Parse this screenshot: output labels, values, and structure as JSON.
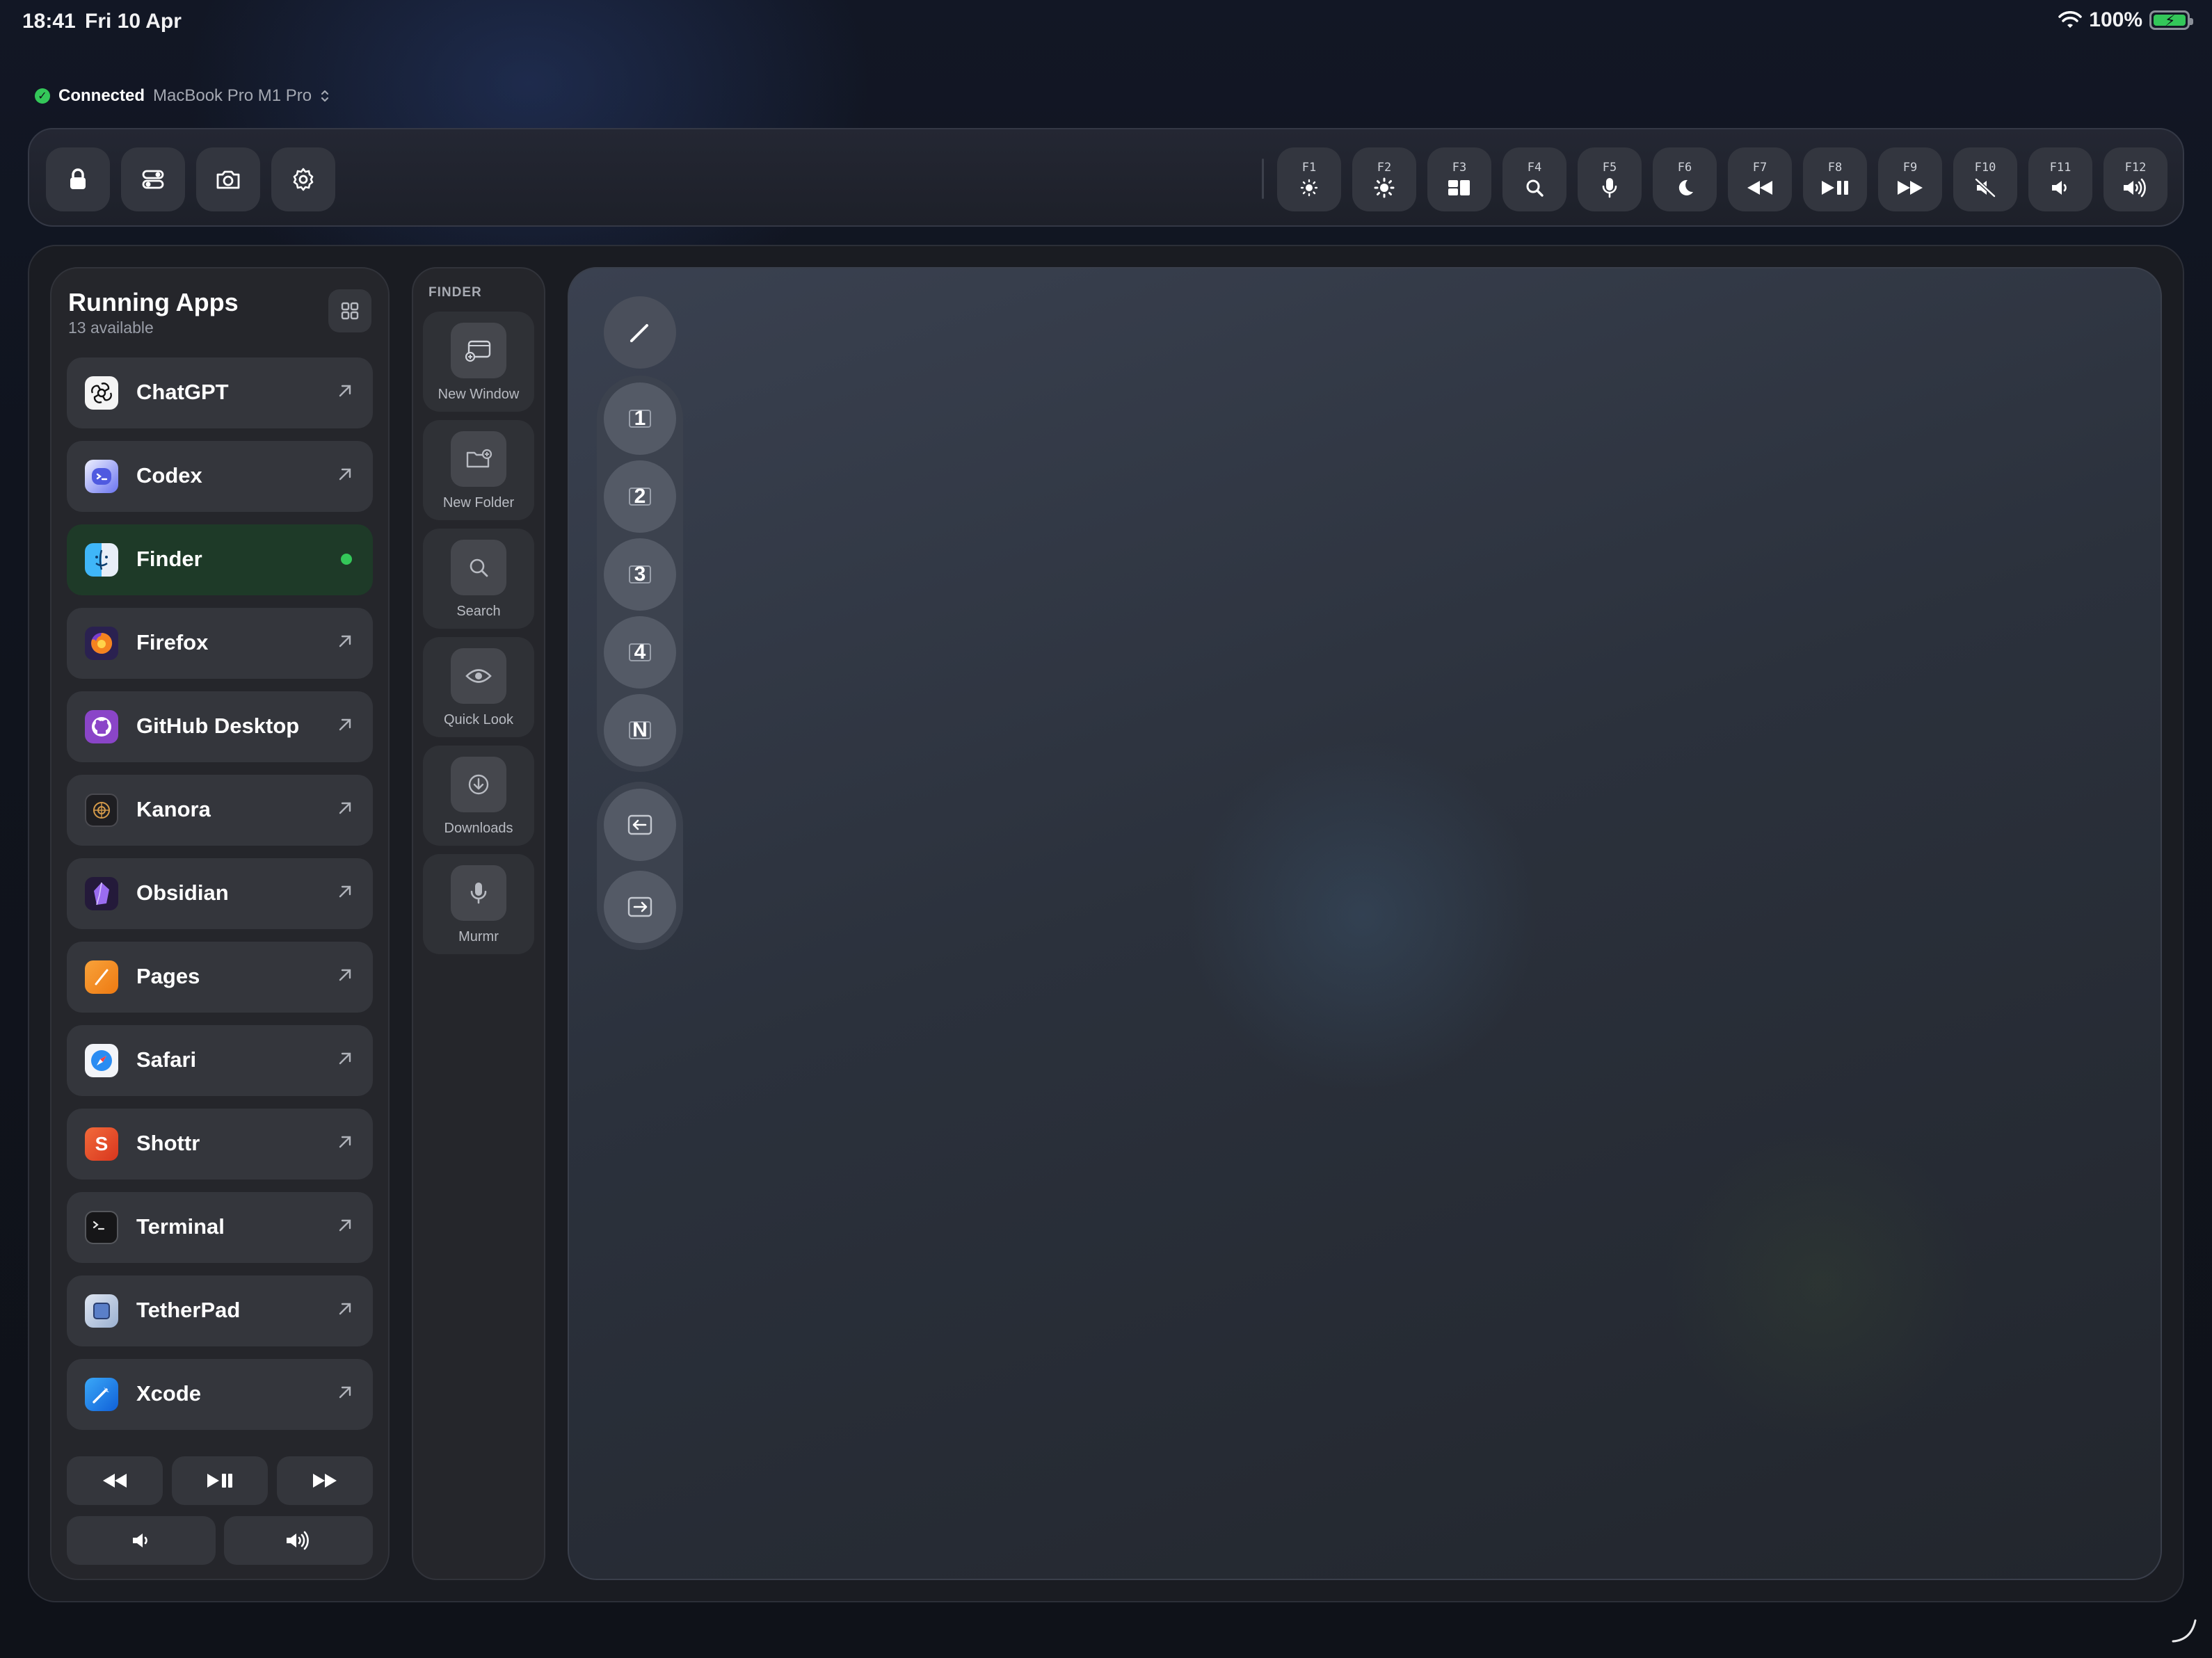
{
  "status_bar": {
    "time": "18:41",
    "date": "Fri 10 Apr",
    "battery": "100%"
  },
  "connection": {
    "status": "Connected",
    "device": "MacBook Pro M1 Pro"
  },
  "toolbar": {
    "left_buttons": [
      "lock-icon",
      "toggles-icon",
      "camera-icon",
      "gear-icon"
    ],
    "fkeys": [
      {
        "label": "F1",
        "icon": "brightness-down-icon"
      },
      {
        "label": "F2",
        "icon": "brightness-up-icon"
      },
      {
        "label": "F3",
        "icon": "mission-control-icon"
      },
      {
        "label": "F4",
        "icon": "spotlight-icon"
      },
      {
        "label": "F5",
        "icon": "dictation-icon"
      },
      {
        "label": "F6",
        "icon": "do-not-disturb-icon"
      },
      {
        "label": "F7",
        "icon": "rewind-icon"
      },
      {
        "label": "F8",
        "icon": "play-pause-icon"
      },
      {
        "label": "F9",
        "icon": "fast-forward-icon"
      },
      {
        "label": "F10",
        "icon": "mute-icon"
      },
      {
        "label": "F11",
        "icon": "volume-down-icon"
      },
      {
        "label": "F12",
        "icon": "volume-up-icon"
      }
    ]
  },
  "running_apps": {
    "title": "Running Apps",
    "subtitle": "13 available",
    "apps": [
      {
        "name": "ChatGPT",
        "active": false
      },
      {
        "name": "Codex",
        "active": false
      },
      {
        "name": "Finder",
        "active": true
      },
      {
        "name": "Firefox",
        "active": false
      },
      {
        "name": "GitHub Desktop",
        "active": false
      },
      {
        "name": "Kanora",
        "active": false
      },
      {
        "name": "Obsidian",
        "active": false
      },
      {
        "name": "Pages",
        "active": false
      },
      {
        "name": "Safari",
        "active": false
      },
      {
        "name": "Shottr",
        "active": false
      },
      {
        "name": "Terminal",
        "active": false
      },
      {
        "name": "TetherPad",
        "active": false
      },
      {
        "name": "Xcode",
        "active": false
      }
    ],
    "app_colors": {
      "ChatGPT": "#f4f4f4",
      "Codex": "#5a64e8",
      "Finder": "#2a9af0",
      "Firefox": "#e8632a",
      "GitHub Desktop": "#7a3fb8",
      "Kanora": "#2a2a2e",
      "Obsidian": "#4a2f8a",
      "Pages": "#f08a1c",
      "Safari": "#1e88f0",
      "Shottr": "#e8442a",
      "Terminal": "#1a1a1c",
      "TetherPad": "#9ab0d0",
      "Xcode": "#1c7ae0"
    },
    "shottr_letter": "S"
  },
  "finder": {
    "title": "FINDER",
    "actions": [
      {
        "label": "New Window",
        "icon": "new-window-icon"
      },
      {
        "label": "New Folder",
        "icon": "new-folder-icon"
      },
      {
        "label": "Search",
        "icon": "search-icon"
      },
      {
        "label": "Quick Look",
        "icon": "eye-icon"
      },
      {
        "label": "Downloads",
        "icon": "download-icon"
      },
      {
        "label": "Murmr",
        "icon": "microphone-icon"
      }
    ]
  },
  "canvas": {
    "desktops": [
      "1",
      "2",
      "3",
      "4",
      "N"
    ]
  },
  "colors": {
    "accent_green": "#34c759",
    "active_row": "#1e3a28"
  }
}
